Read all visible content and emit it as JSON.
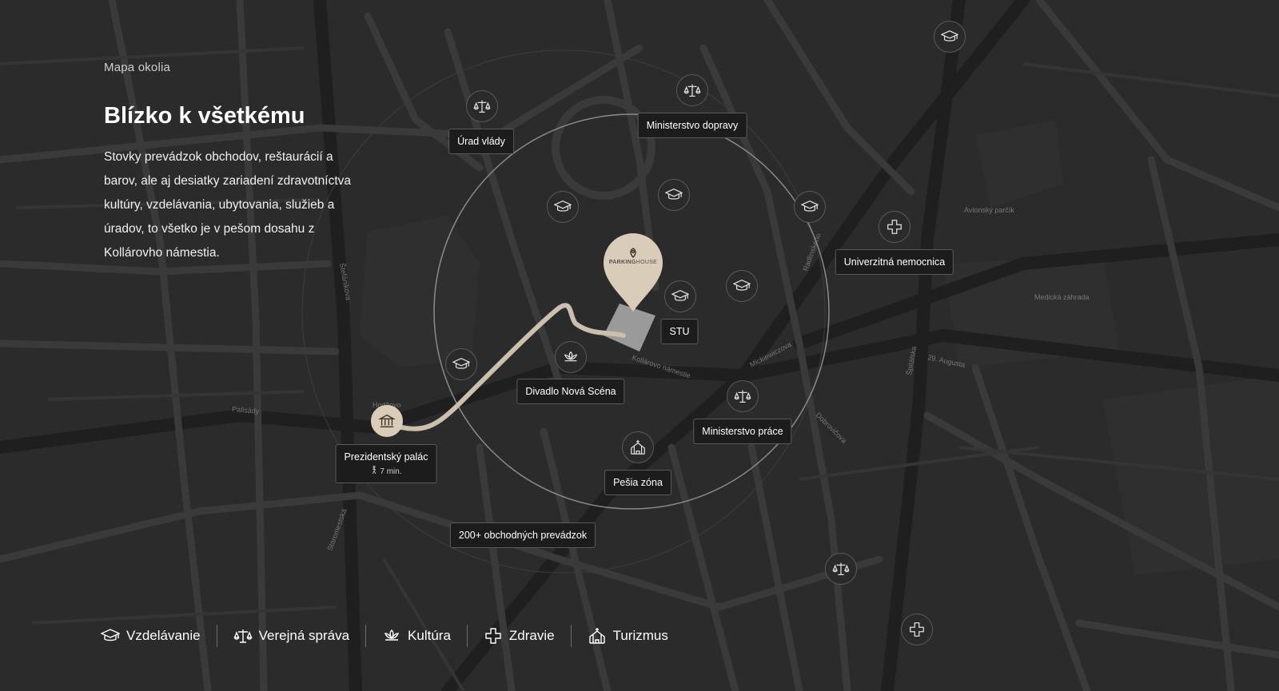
{
  "header": {
    "eyebrow": "Mapa okolia",
    "title": "Blízko k všetkému",
    "description": "Stovky prevádzok obchodov, reštaurácií a barov, ale aj desiatky zariadení zdravotníctva kultúry, vzdelávania, ubytovania, služieb a úradov, to všetko je v pešom dosahu z Kollárovho námestia."
  },
  "pin": {
    "brand_bold": "PARKING",
    "brand_light": "HOUSE"
  },
  "labels": {
    "urad_vlady": "Úrad vlády",
    "min_dopravy": "Ministerstvo dopravy",
    "nemocnica": "Univerzitná nemocnica",
    "stu": "STU",
    "divadlo": "Divadlo Nová Scéna",
    "min_prace": "Ministerstvo práce",
    "pesia_zona": "Pešia zóna",
    "obchody": "200+ obchodných prevádzok",
    "palac": "Prezidentský palác",
    "palac_time": "7 min."
  },
  "street_labels": {
    "hodzovo": "Hodžovo",
    "palisady": "Palisády",
    "stefanikova": "Štefánikova",
    "kollarovo": "Kollárovo námestie",
    "spitalska": "Špitálska",
    "mickiewiczova": "Mickiewiczova",
    "avgusta": "29. Augusta",
    "staromestska": "Staromestská",
    "medicka_zahrada": "Medická záhrada",
    "avionsky_parcik": "Avionský parčík",
    "radlinskeho": "Radlinského",
    "dobrovicova": "Dobrovičova"
  },
  "legend": [
    {
      "icon": "graduation-cap-icon",
      "label": "Vzdelávanie"
    },
    {
      "icon": "scales-icon",
      "label": "Verejná správa"
    },
    {
      "icon": "lotus-icon",
      "label": "Kultúra"
    },
    {
      "icon": "cross-icon",
      "label": "Zdravie"
    },
    {
      "icon": "church-icon",
      "label": "Turizmus"
    }
  ],
  "colors": {
    "background": "#2b2b2b",
    "road": "#3b3b3b",
    "accent": "#d9ccb8",
    "label_bg": "#1c1c1c"
  }
}
